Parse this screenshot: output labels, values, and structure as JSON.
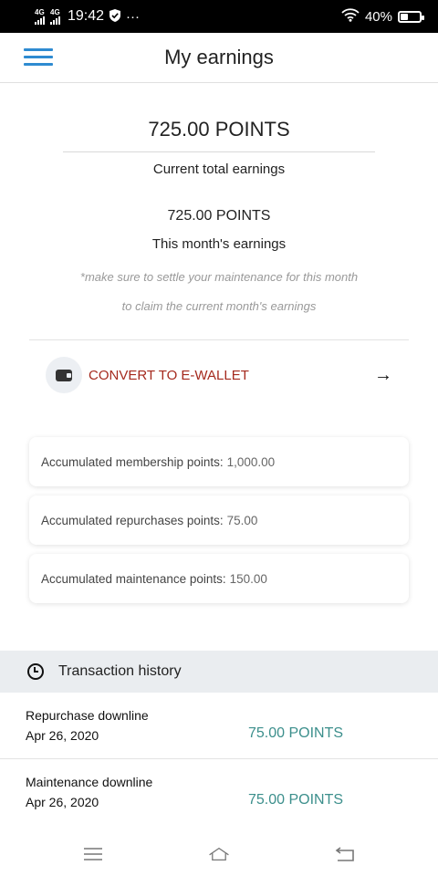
{
  "status": {
    "network1": "4G",
    "network2": "4G",
    "time": "19:42",
    "more": "···",
    "battery": "40%",
    "battery_level": 0.4
  },
  "app_bar": {
    "title": "My earnings"
  },
  "earnings": {
    "total_points": "725.00 POINTS",
    "total_caption": "Current total earnings",
    "month_points": "725.00 POINTS",
    "month_caption": "This month's earnings",
    "note_line1": "*make sure to settle your maintenance for this month",
    "note_line2": "to claim the current month's earnings"
  },
  "convert": {
    "label": "CONVERT TO E-WALLET",
    "arrow": "→"
  },
  "points": [
    {
      "label": "Accumulated membership points:",
      "value": "1,000.00"
    },
    {
      "label": "Accumulated repurchases points:",
      "value": "75.00"
    },
    {
      "label": "Accumulated maintenance points:",
      "value": "150.00"
    }
  ],
  "transactions": {
    "title": "Transaction history",
    "items": [
      {
        "name": "Repurchase downline",
        "date": "Apr 26, 2020",
        "amount": "75.00 POINTS"
      },
      {
        "name": "Maintenance downline",
        "date": "Apr 26, 2020",
        "amount": "75.00 POINTS"
      }
    ]
  },
  "colors": {
    "accent": "#2e8bd1",
    "convert": "#a52a1e",
    "amount": "#3c8f8c"
  }
}
